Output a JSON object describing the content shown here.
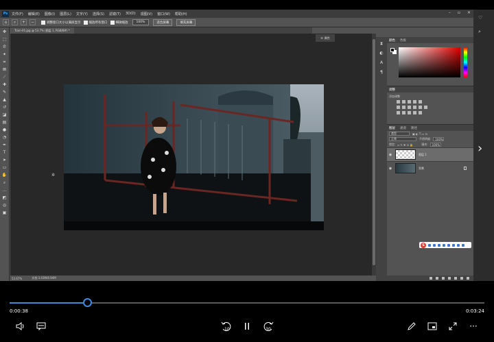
{
  "photoshop": {
    "logo": "Ps",
    "menu": [
      "文件(F)",
      "编辑(E)",
      "图像(I)",
      "图层(L)",
      "文字(Y)",
      "选择(S)",
      "滤镜(T)",
      "3D(D)",
      "视图(V)",
      "窗口(W)",
      "帮助(H)"
    ],
    "options": {
      "resize_windows": "调整窗口大小以满屏显示",
      "zoom_all": "缩放所有窗口",
      "scrubby_zoom": "细微缩放",
      "zoom_value": "100%",
      "fit_screen": "适合屏幕",
      "fill_screen": "填充屏幕"
    },
    "doc_tab": "Train-01.jpg @ 53.7% (图层 1, RGB/8#) *",
    "status": {
      "zoom": "53.67%",
      "doc": "文档:3.43M/6.94M"
    },
    "color_panel": {
      "tabs": [
        "颜色",
        "色板"
      ]
    },
    "adjust_panel": {
      "title": "调整",
      "add_label": "添加调整"
    },
    "layers_panel": {
      "tabs": [
        "图层",
        "通道",
        "路径"
      ],
      "filter": "类型",
      "blend_mode": "正常",
      "opacity_label": "不透明度:",
      "opacity_value": "100%",
      "lock_label": "锁定:",
      "fill_label": "填充:",
      "fill_value": "100%",
      "layers": [
        {
          "name": "图层 1",
          "selected": true
        },
        {
          "name": "背景",
          "selected": false
        }
      ]
    },
    "prop_button": "属性"
  },
  "player": {
    "current_time": "0:00:38",
    "total_time": "0:03:24",
    "progress": 0.164,
    "skip_back": "10",
    "skip_forward": "30"
  },
  "colors": {
    "accent": "#3f8ae0",
    "ps_bg": "#535353",
    "canvas_bg": "#282828"
  }
}
